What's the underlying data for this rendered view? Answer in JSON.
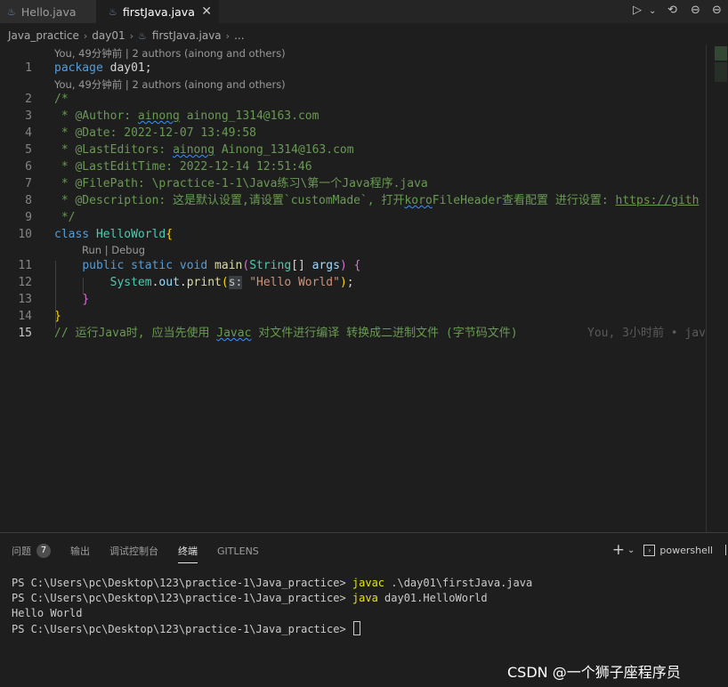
{
  "tabs": [
    {
      "label": "Hello.java",
      "icon": "java-file-icon",
      "active": false
    },
    {
      "label": "firstJava.java",
      "icon": "java-file-icon",
      "active": true
    }
  ],
  "breadcrumb": {
    "items": [
      "Java_practice",
      "day01",
      "firstJava.java",
      "..."
    ]
  },
  "editor": {
    "codelens_line1": "You, 49分钟前 | 2 authors (ainong and others)",
    "codelens_line2": "You, 49分钟前 | 2 authors (ainong and others)",
    "run_debug": "Run | Debug",
    "line_numbers": [
      "1",
      "2",
      "3",
      "4",
      "5",
      "6",
      "7",
      "8",
      "9",
      "10",
      "11",
      "12",
      "13",
      "14",
      "15"
    ],
    "code": {
      "l1_kw": "package",
      "l1_pkg": "day01",
      "l1_semi": ";",
      "l2": "/*",
      "l3_pre": " * @Author: ",
      "l3_sq": "ainong",
      "l3_post": " ainong_1314@163.com",
      "l4": " * @Date: 2022-12-07 13:49:58",
      "l5_pre": " * @LastEditors: ",
      "l5_sq": "ainong",
      "l5_post": " Ainong_1314@163.com",
      "l6": " * @LastEditTime: 2022-12-14 12:51:46",
      "l7": " * @FilePath: \\practice-1-1\\Java练习\\第一个Java程序.java",
      "l8_pre": " * @Description: 这是默认设置,请设置`customMade`, 打开",
      "l8_sq": "koro",
      "l8_mid": "FileHeader查看配置 进行设置: ",
      "l8_link": "https://gith",
      "l9": " */",
      "l10_kw": "class",
      "l10_name": "HelloWorld",
      "l10_br": "{",
      "l11_kw1": "public",
      "l11_kw2": "static",
      "l11_kw3": "void",
      "l11_fn": "main",
      "l11_p1": "(",
      "l11_ty": "String",
      "l11_arr": "[]",
      "l11_arg": "args",
      "l11_p2": ")",
      "l11_br": "{",
      "l12_cls": "System",
      "l12_out": "out",
      "l12_fn": "print",
      "l12_p1": "(",
      "l12_hint": "s:",
      "l12_str": "\"Hello World\"",
      "l12_p2": ")",
      "l12_semi": ";",
      "l13": "}",
      "l14": "}",
      "l15_pre": "// 运行Java时, 应当先使用 ",
      "l15_sq": "Javac",
      "l15_post": " 对文件进行编译 转换成二进制文件 (字节码文件)",
      "l15_blame": "You, 3小时前 • jav"
    }
  },
  "panel": {
    "tabs": [
      "问题",
      "输出",
      "调试控制台",
      "终端",
      "GITLENS"
    ],
    "problems_count": "7",
    "active_tab": "终端",
    "shell": "powershell",
    "terminal": {
      "prompt": "PS C:\\Users\\pc\\Desktop\\123\\practice-1\\Java_practice> ",
      "cmd1": "javac",
      "cmd1_args": " .\\day01\\firstJava.java",
      "cmd2": "java",
      "cmd2_args": " day01.HelloWorld",
      "output": "Hello World"
    }
  },
  "watermark": "CSDN @一个狮子座程序员"
}
